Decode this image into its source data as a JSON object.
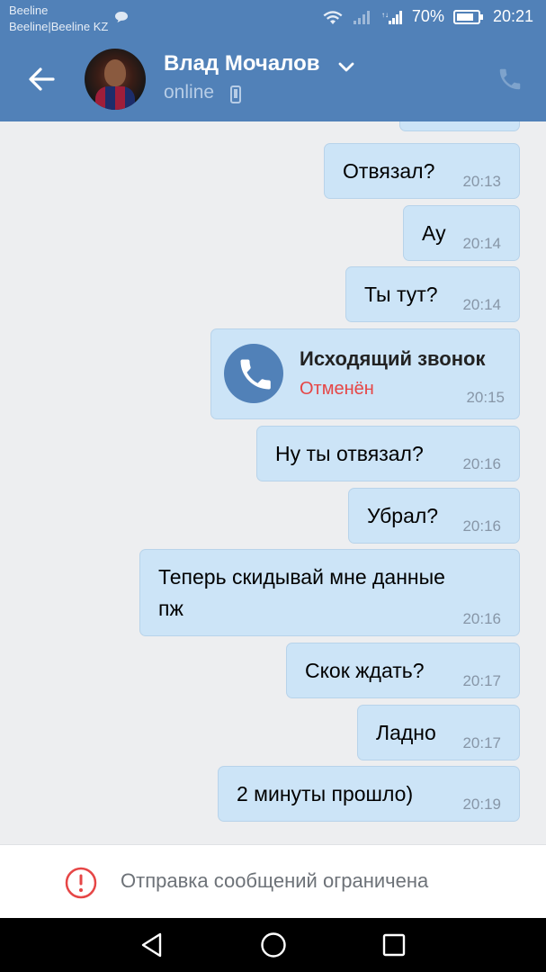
{
  "statusbar": {
    "carrier_line1": "Beeline",
    "carrier_line2": "Beeline|Beeline KZ",
    "battery": "70%",
    "time": "20:21"
  },
  "header": {
    "contact_name": "Влад Мочалов",
    "presence": "online"
  },
  "messages": [
    {
      "text": "Отвязал?",
      "time": "20:13"
    },
    {
      "text": "Ау",
      "time": "20:14"
    },
    {
      "text": "Ты тут?",
      "time": "20:14"
    },
    {
      "call_title": "Исходящий звонок",
      "call_status": "Отменён",
      "time": "20:15"
    },
    {
      "text": "Ну ты отвязал?",
      "time": "20:16"
    },
    {
      "text": "Убрал?",
      "time": "20:16"
    },
    {
      "text": "Теперь скидывай мне данные",
      "text2": "пж",
      "time": "20:16"
    },
    {
      "text": "Скок ждать?",
      "time": "20:17"
    },
    {
      "text": "Ладно",
      "time": "20:17"
    },
    {
      "text": "2 минуты прошло)",
      "time": "20:19"
    }
  ],
  "footer": {
    "notice": "Отправка сообщений ограничена"
  },
  "colors": {
    "accent": "#5181b8",
    "bubble": "#cce4f7",
    "error": "#e64646"
  },
  "icons": [
    "back-arrow-icon",
    "chevron-down-icon",
    "mobile-phone-icon",
    "phone-icon",
    "alert-icon",
    "nav-back-icon",
    "nav-home-icon",
    "nav-recent-icon"
  ]
}
